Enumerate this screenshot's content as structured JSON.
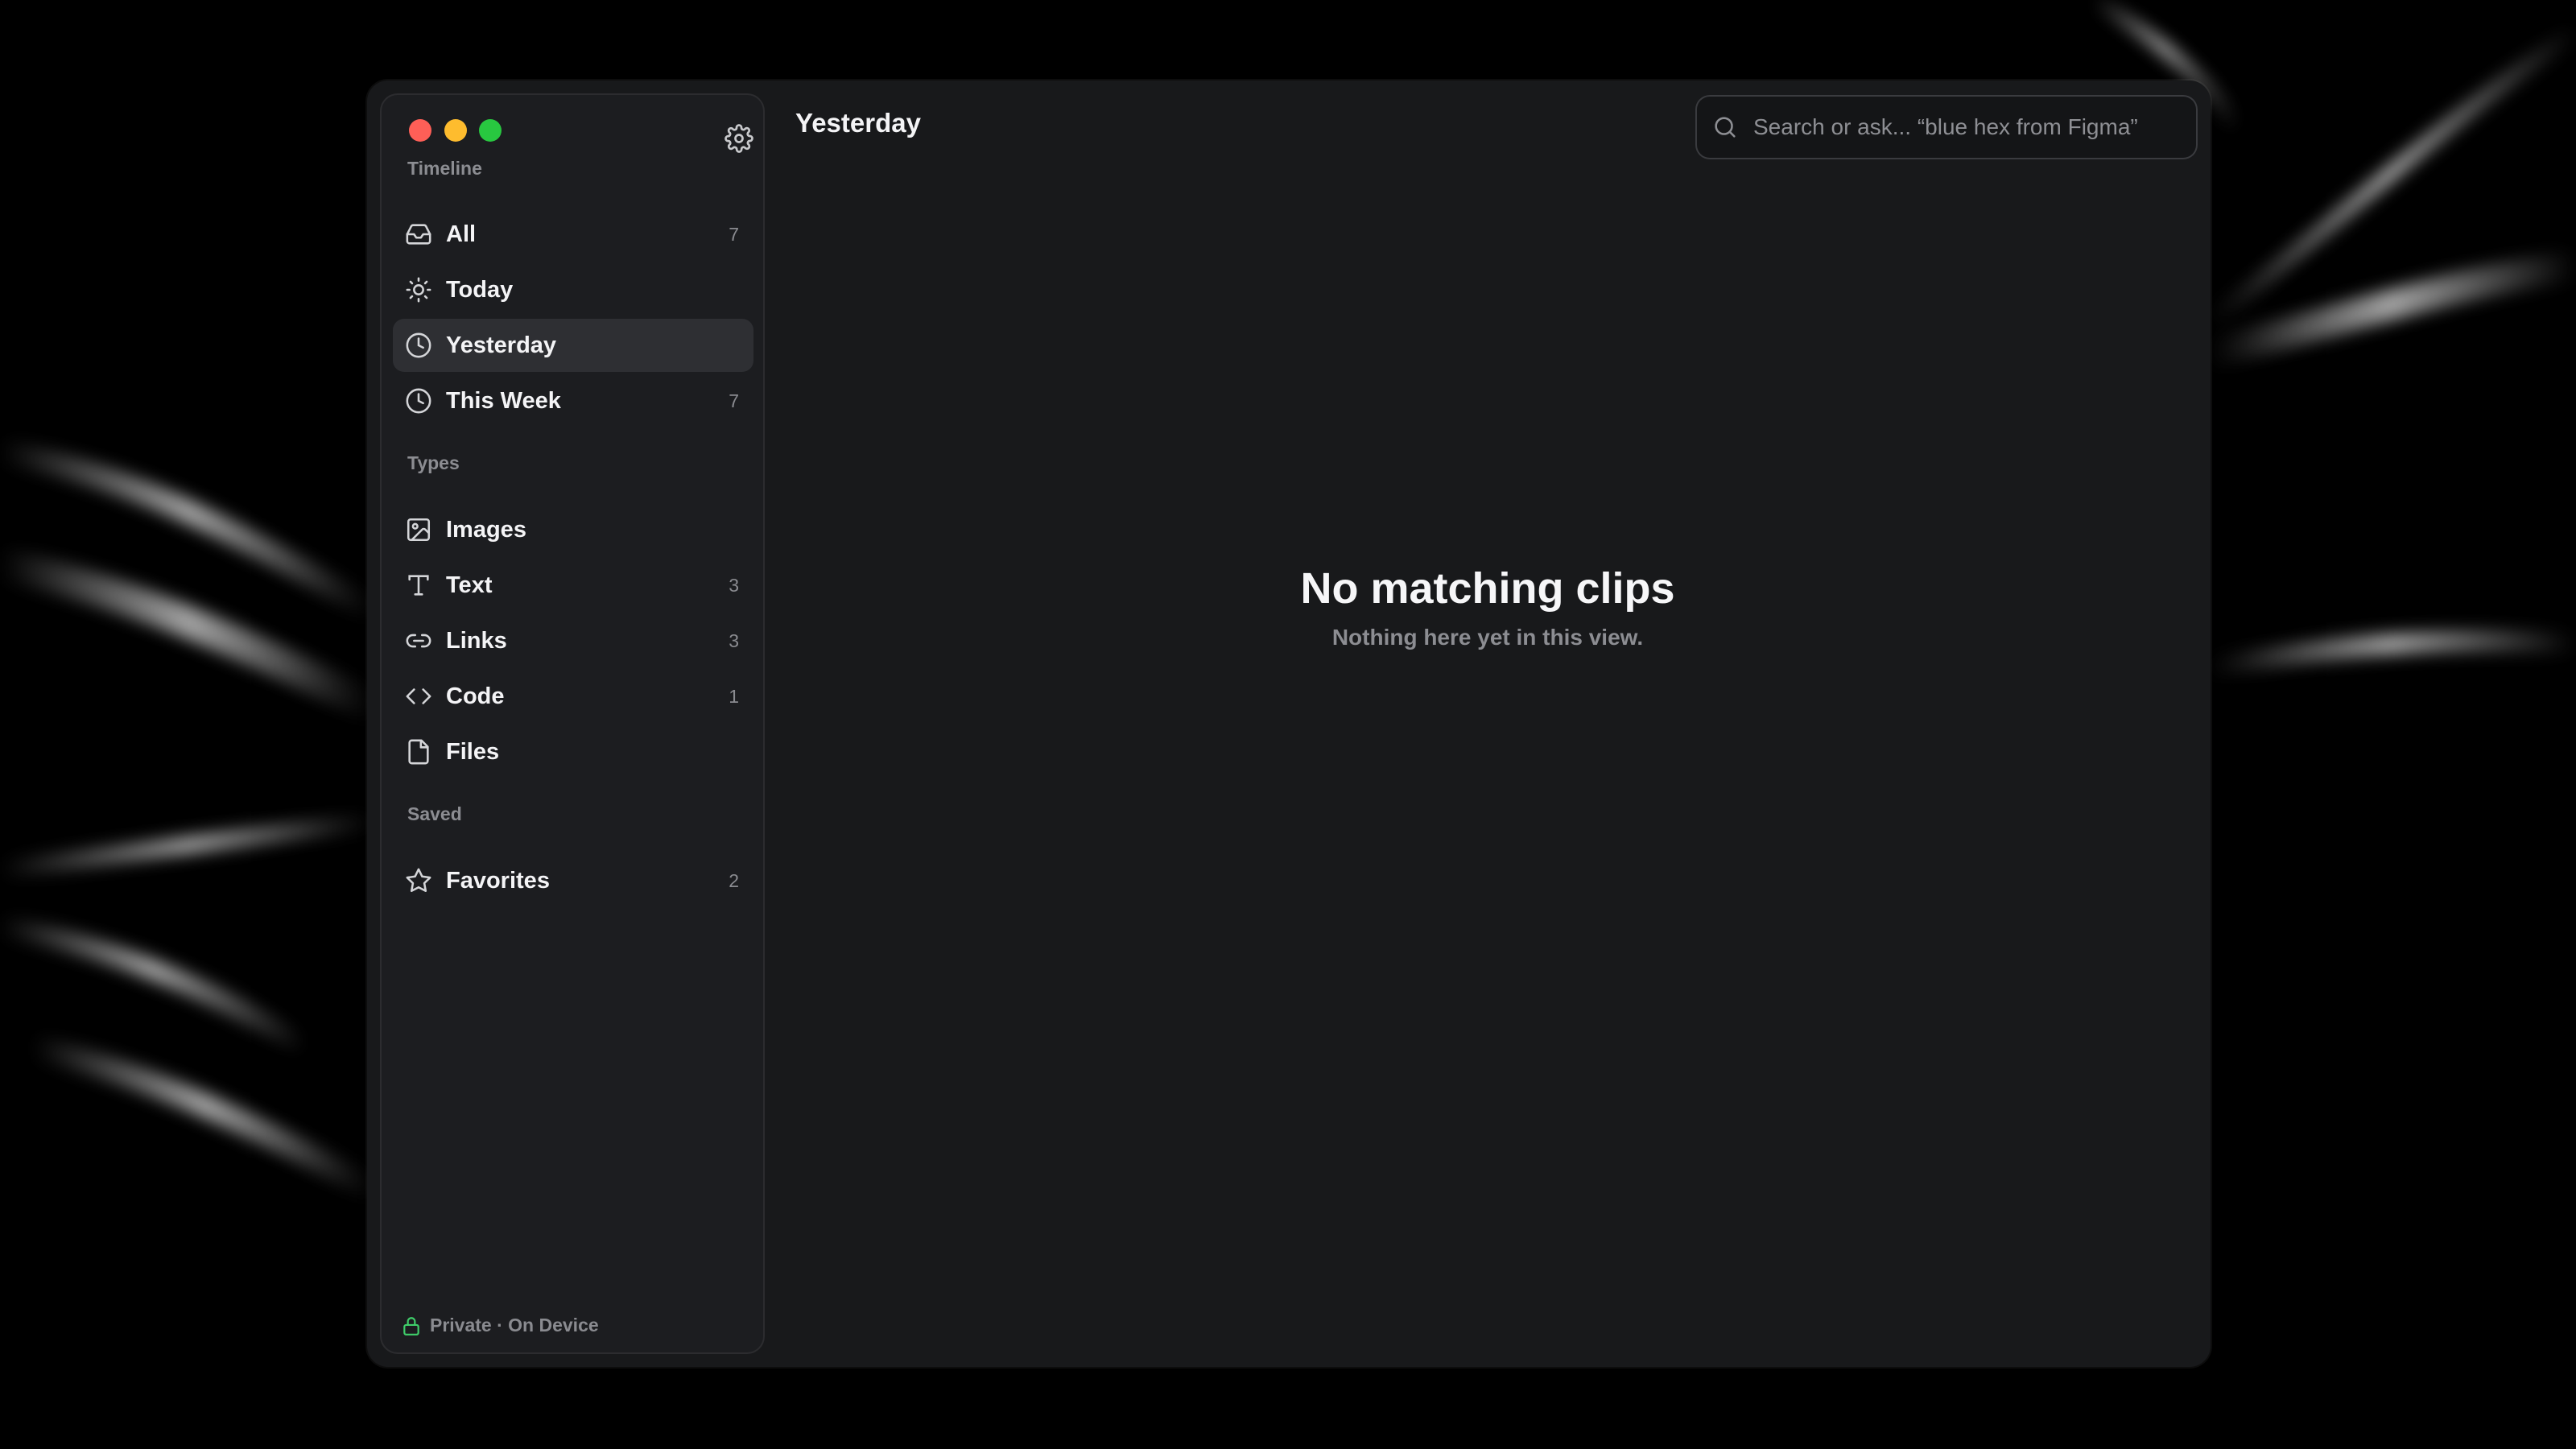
{
  "window": {
    "controls": [
      "close",
      "minimize",
      "maximize"
    ],
    "title": "Yesterday"
  },
  "sidebar": {
    "settings_icon": "gear-icon",
    "sections": [
      {
        "label": "Timeline",
        "items": [
          {
            "label": "All",
            "count": "7",
            "icon": "inbox-icon"
          },
          {
            "label": "Today",
            "count": "",
            "icon": "sun-icon"
          },
          {
            "label": "Yesterday",
            "count": "",
            "icon": "clock-icon",
            "active": true
          },
          {
            "label": "This Week",
            "count": "7",
            "icon": "clock-icon"
          }
        ]
      },
      {
        "label": "Types",
        "items": [
          {
            "label": "Images",
            "count": "",
            "icon": "image-icon"
          },
          {
            "label": "Text",
            "count": "3",
            "icon": "text-icon"
          },
          {
            "label": "Links",
            "count": "3",
            "icon": "link-icon"
          },
          {
            "label": "Code",
            "count": "1",
            "icon": "code-icon"
          },
          {
            "label": "Files",
            "count": "",
            "icon": "file-icon"
          }
        ]
      },
      {
        "label": "Saved",
        "items": [
          {
            "label": "Favorites",
            "count": "2",
            "icon": "star-icon"
          }
        ]
      }
    ],
    "footer": "Private · On Device"
  },
  "search": {
    "placeholder": "Search or ask... “blue hex from Figma”",
    "value": ""
  },
  "empty_state": {
    "title": "No matching clips",
    "subtitle": "Nothing here yet in this view."
  },
  "colors": {
    "close": "#fe5f57",
    "minimize": "#febc2e",
    "maximize": "#28c840",
    "lock_accent": "#3fce6a"
  }
}
